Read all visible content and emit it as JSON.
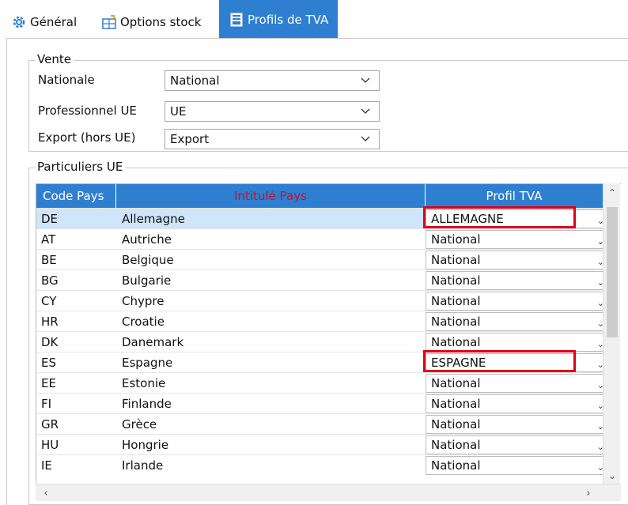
{
  "tabs": [
    {
      "label": "Général",
      "icon": "gear-icon"
    },
    {
      "label": "Options stock",
      "icon": "stock-icon"
    },
    {
      "label": "Profils de TVA",
      "icon": "tva-icon"
    }
  ],
  "vente": {
    "legend": "Vente",
    "rows": [
      {
        "label": "Nationale",
        "value": "National"
      },
      {
        "label": "Professionnel UE",
        "value": "UE"
      },
      {
        "label": "Export (hors UE)",
        "value": "Export"
      }
    ]
  },
  "particuliers": {
    "legend": "Particuliers UE",
    "columns": {
      "code": "Code Pays",
      "name": "Intitulé Pays",
      "profil": "Profil TVA"
    },
    "rows": [
      {
        "code": "DE",
        "name": "Allemagne",
        "profil": "ALLEMAGNE"
      },
      {
        "code": "AT",
        "name": "Autriche",
        "profil": "National"
      },
      {
        "code": "BE",
        "name": "Belgique",
        "profil": "National"
      },
      {
        "code": "BG",
        "name": "Bulgarie",
        "profil": "National"
      },
      {
        "code": "CY",
        "name": "Chypre",
        "profil": "National"
      },
      {
        "code": "HR",
        "name": "Croatie",
        "profil": "National"
      },
      {
        "code": "DK",
        "name": "Danemark",
        "profil": "National"
      },
      {
        "code": "ES",
        "name": "Espagne",
        "profil": "ESPAGNE"
      },
      {
        "code": "EE",
        "name": "Estonie",
        "profil": "National"
      },
      {
        "code": "FI",
        "name": "Finlande",
        "profil": "National"
      },
      {
        "code": "GR",
        "name": "Grèce",
        "profil": "National"
      },
      {
        "code": "HU",
        "name": "Hongrie",
        "profil": "National"
      },
      {
        "code": "IE",
        "name": "Irlande",
        "profil": "National"
      }
    ]
  },
  "colors": {
    "accent": "#2f7fd1",
    "highlight": "#e0001a",
    "selected_row": "#cfe5f9"
  }
}
